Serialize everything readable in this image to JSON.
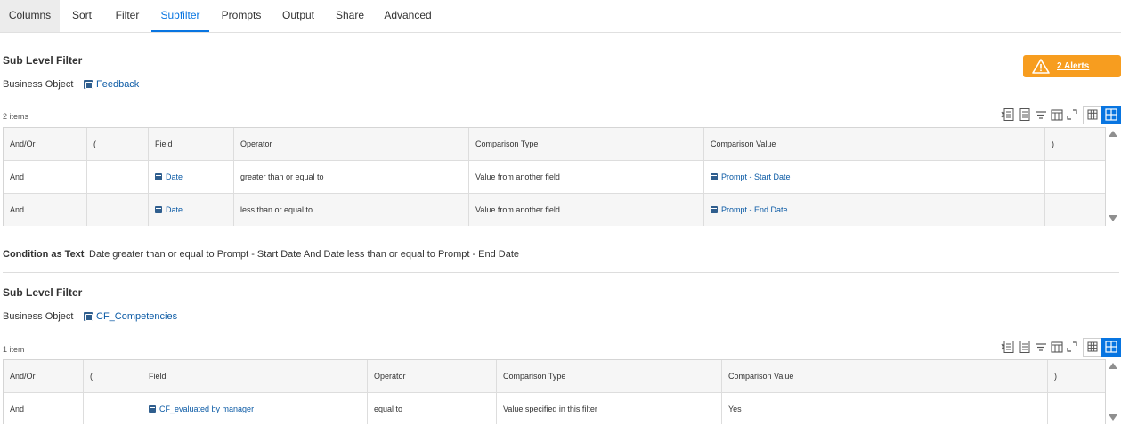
{
  "tabs": [
    {
      "label": "Columns"
    },
    {
      "label": "Sort"
    },
    {
      "label": "Filter"
    },
    {
      "label": "Subfilter"
    },
    {
      "label": "Prompts"
    },
    {
      "label": "Output"
    },
    {
      "label": "Share"
    },
    {
      "label": "Advanced"
    }
  ],
  "active_tab": "Subfilter",
  "alerts": {
    "label": "2 Alerts",
    "color": "#f79d1f"
  },
  "accent_color": "#0875e1",
  "filter1": {
    "title": "Sub Level Filter",
    "bo_label": "Business Object",
    "bo_value": "Feedback",
    "count": "2 items",
    "headers": [
      "And/Or",
      "(",
      "Field",
      "Operator",
      "Comparison Type",
      "Comparison Value",
      ")"
    ],
    "rows": [
      {
        "andor": "And",
        "open": "",
        "field": "Date",
        "operator": "greater than or equal to",
        "ctype": "Value from another field",
        "cvalue": "Prompt - Start Date",
        "close": ""
      },
      {
        "andor": "And",
        "open": "",
        "field": "Date",
        "operator": "less than or equal to",
        "ctype": "Value from another field",
        "cvalue": "Prompt - End Date",
        "close": ""
      }
    ]
  },
  "condition": {
    "label": "Condition as Text",
    "text": "Date greater than or equal to Prompt - Start Date And Date less than or equal to Prompt - End Date"
  },
  "filter2": {
    "title": "Sub Level Filter",
    "bo_label": "Business Object",
    "bo_value": "CF_Competencies",
    "count": "1 item",
    "headers": [
      "And/Or",
      "(",
      "Field",
      "Operator",
      "Comparison Type",
      "Comparison Value",
      ")"
    ],
    "rows": [
      {
        "andor": "And",
        "open": "",
        "field": "CF_evaluated by manager",
        "operator": "equal to",
        "ctype": "Value specified in this filter",
        "cvalue": "Yes",
        "close": ""
      }
    ]
  },
  "toolbar_icons": [
    "export-excel-icon",
    "export-pdf-icon",
    "filter-icon",
    "columns-icon",
    "expand-icon",
    "table-view-icon",
    "grid-view-icon"
  ]
}
